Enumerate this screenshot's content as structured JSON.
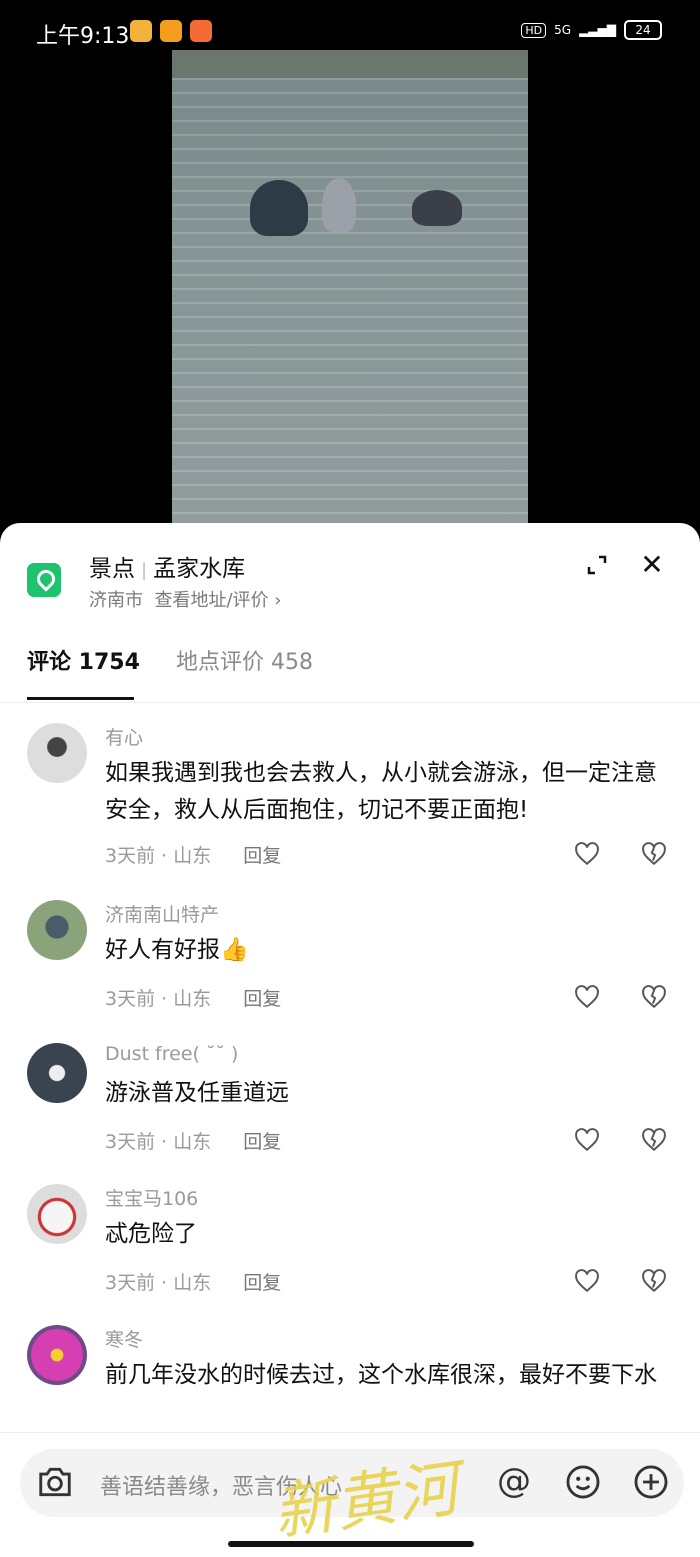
{
  "status": {
    "time": "上午9:13",
    "hd": "HD",
    "network": "5G",
    "battery": "24"
  },
  "place": {
    "category": "景点",
    "name": "孟家水库",
    "city": "济南市",
    "link": "查看地址/评价 ›"
  },
  "tabs": [
    {
      "label": "评论 1754"
    },
    {
      "label": "地点评价 458"
    }
  ],
  "comments": [
    {
      "name": "有心",
      "text": "如果我遇到我也会去救人，从小就会游泳，但一定注意安全，救人从后面抱住，切记不要正面抱!",
      "time": "3天前",
      "region": "山东",
      "reply": "回复"
    },
    {
      "name": "济南南山特产",
      "text": "好人有好报👍",
      "time": "3天前",
      "region": "山东",
      "reply": "回复"
    },
    {
      "name": "Dust free( ˘˘ )",
      "text": "游泳普及任重道远",
      "time": "3天前",
      "region": "山东",
      "reply": "回复"
    },
    {
      "name": "宝宝马106",
      "text": "忒危险了",
      "time": "3天前",
      "region": "山东",
      "reply": "回复"
    },
    {
      "name": "寒冬",
      "text": "前几年没水的时候去过，这个水库很深，最好不要下水",
      "time": "",
      "region": "",
      "reply": ""
    }
  ],
  "input": {
    "placeholder": "善语结善缘，恶言伤人心",
    "at": "@"
  },
  "watermark": "新黄河",
  "colors": {
    "accent": "#1ec36d",
    "text": "#111111",
    "muted": "#9a9a9a",
    "watermark": "#e8d24a"
  }
}
